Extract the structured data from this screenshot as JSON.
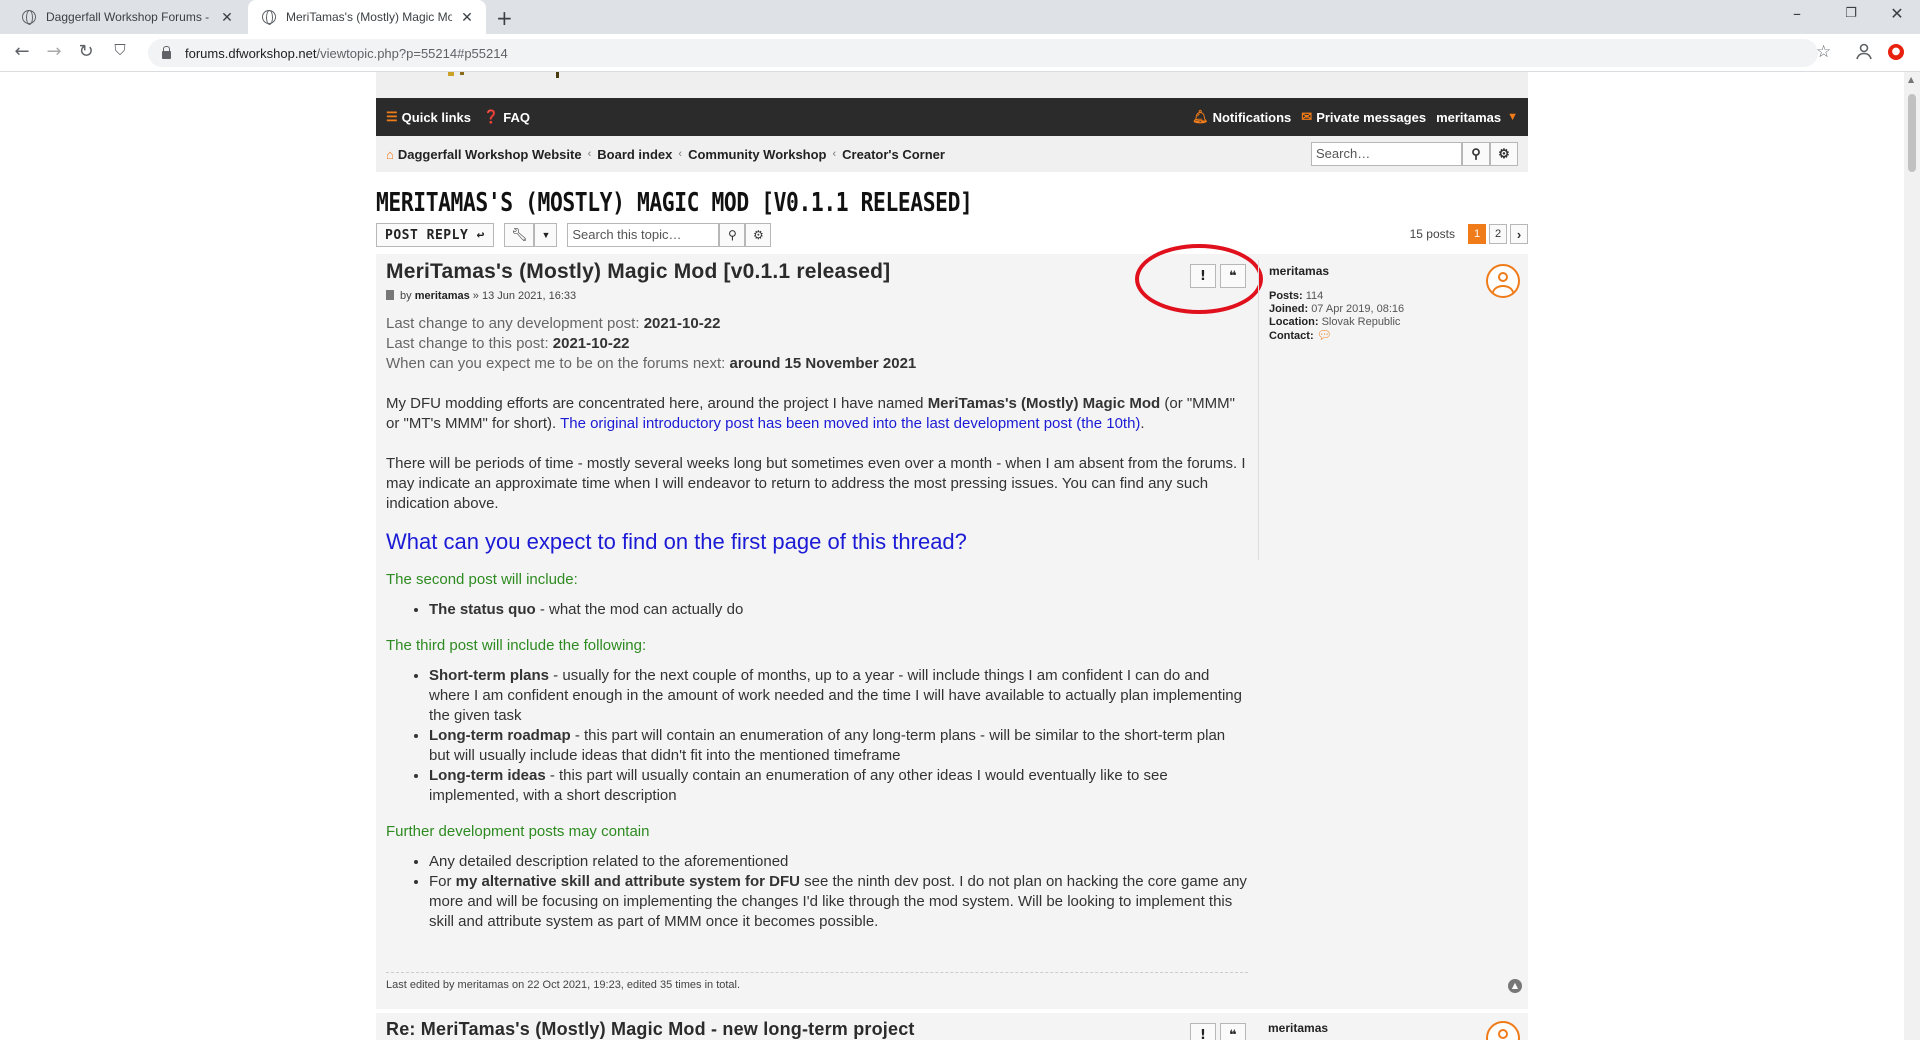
{
  "browser": {
    "tabs": [
      {
        "title": "Daggerfall Workshop Forums - U",
        "active": false
      },
      {
        "title": "MeriTamas's (Mostly) Magic Mo",
        "active": true
      }
    ],
    "url_host": "forums.dfworkshop.net",
    "url_path": "/viewtopic.php?p=55214#p55214",
    "new_tab": "+",
    "minimize": "–",
    "restore": "❐",
    "close": "✕"
  },
  "nav": {
    "quick_links": "Quick links",
    "faq": "FAQ",
    "notifications": "Notifications",
    "private_messages": "Private messages",
    "username": "meritamas"
  },
  "breadcrumb": {
    "items": [
      "Daggerfall Workshop Website",
      "Board index",
      "Community Workshop",
      "Creator's Corner"
    ],
    "search_placeholder": "Search…"
  },
  "topic": {
    "title": "MERITAMAS'S (MOSTLY) MAGIC MOD [V0.1.1 RELEASED]",
    "post_reply": "POST REPLY",
    "search_placeholder": "Search this topic…",
    "post_count": "15 posts",
    "pages": [
      "1",
      "2"
    ],
    "current_page": "1"
  },
  "post1": {
    "title": "MeriTamas's (Mostly) Magic Mod [v0.1.1 released]",
    "by": "by",
    "author": "meritamas",
    "date": "» 13 Jun 2021, 16:33",
    "l1_label": "Last change to any development post: ",
    "l1_value": "2021-10-22",
    "l2_label": "Last change to this post: ",
    "l2_value": "2021-10-22",
    "l3_label": "When can you expect me to be on the forums next: ",
    "l3_value": "around 15 November 2021",
    "p1_a": "My DFU modding efforts are concentrated here, around the project I have named ",
    "p1_b": "MeriTamas's (Mostly) Magic Mod",
    "p1_c": " (or \"MMM\" or \"MT's MMM\" for short). ",
    "p1_link": "The original introductory post has been moved into the last development post (the 10th)",
    "p1_d": ".",
    "p2": "There will be periods of time - mostly several weeks long but sometimes even over a month - when I am absent from the forums. I may indicate an approximate time when I will endeavor to return to address the most pressing issues. You can find any such indication above.",
    "heading": "What can you expect to find on the first page of this thread?",
    "second_label": "The second post will include:",
    "second_items": [
      {
        "bold": "The status quo",
        "text": " - what the mod can actually do"
      }
    ],
    "third_label": "The third post will include the following:",
    "third_items": [
      {
        "bold": "Short-term plans",
        "text": " - usually for the next couple of months, up to a year - will include things I am confident I can do and where I am confident enough in the amount of work needed and the time I will have available to actually plan implementing the given task"
      },
      {
        "bold": "Long-term roadmap",
        "text": " - this part will contain an enumeration of any long-term plans - will be similar to the short-term plan but will usually include ideas that didn't fit into the mentioned timeframe"
      },
      {
        "bold": "Long-term ideas",
        "text": " - this part will usually contain an enumeration of any other ideas I would eventually like to see implemented, with a short description"
      }
    ],
    "further_label": "Further development posts may contain",
    "further_item1": "Any detailed description related to the aforementioned",
    "further_item2_a": "For ",
    "further_item2_b": "my alternative skill and attribute system for DFU",
    "further_item2_c": " see the ninth dev post. I do not plan on hacking the core game any more and will be focusing on implementing the changes I'd like through the mod system. Will be looking to implement this skill and attribute system as part of MMM once it becomes possible.",
    "last_edited": "Last edited by meritamas on 22 Oct 2021, 19:23, edited 35 times in total."
  },
  "profile": {
    "username": "meritamas",
    "posts_label": "Posts:",
    "posts": "114",
    "joined_label": "Joined:",
    "joined": "07 Apr 2019, 08:16",
    "location_label": "Location:",
    "location": "Slovak Republic",
    "contact_label": "Contact:"
  },
  "post2": {
    "title": "Re: MeriTamas's (Mostly) Magic Mod - new long-term project",
    "username": "meritamas"
  },
  "colors": {
    "accent": "#ef7b19",
    "navbar": "#2b2b2b",
    "link": "#1b1bd6",
    "green_label": "#2e8b21",
    "annotation_circle": "#e0101c"
  }
}
